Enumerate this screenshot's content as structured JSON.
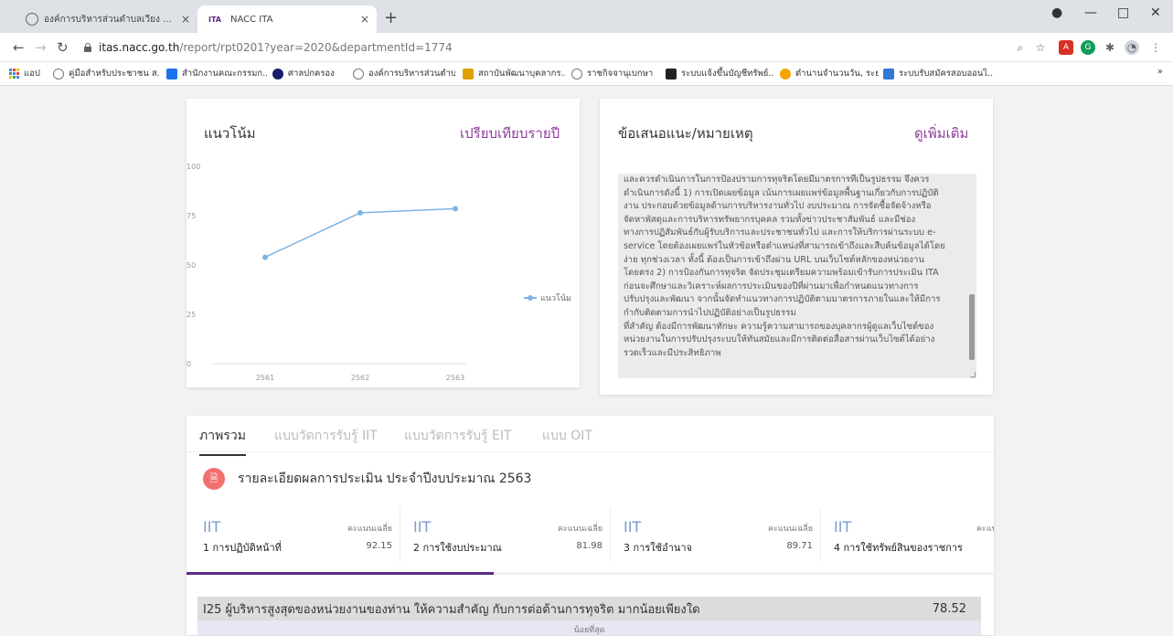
{
  "browser": {
    "tabs": [
      {
        "title": "องค์การบริหารส่วนตำบลเวียง อ.เวียงป่าเป้า",
        "active": false
      },
      {
        "title": "NACC ITA",
        "active": true
      }
    ],
    "tab_favicon_text": "ITA",
    "new_tab": "+",
    "close_glyph": "×",
    "url_host": "itas.nacc.go.th",
    "url_path": "/report/rpt0201?year=2020&departmentId=1774",
    "bookmarks": [
      {
        "label": "แอป",
        "color": "#4285f4"
      },
      {
        "label": "คู่มือสำหรับประชาชน ส...",
        "color": "#888888"
      },
      {
        "label": "สำนักงานคณะกรรมก...",
        "color": "#1a73e8"
      },
      {
        "label": "ศาลปกครอง",
        "color": "#1b1b6b"
      },
      {
        "label": "องค์การบริหารส่วนตำบ...",
        "color": "#888888"
      },
      {
        "label": "สถาบันพัฒนาบุคลากร...",
        "color": "#e0a000"
      },
      {
        "label": "ราชกิจจานุเบกษา",
        "color": "#888888"
      },
      {
        "label": "ระบบแจ้งขึ้นบัญชีทรัพย์...",
        "color": "#222222"
      },
      {
        "label": "ตำนานจำนวนวัน, ระยะ...",
        "color": "#f4a300"
      },
      {
        "label": "ระบบรับสมัครสอบออนไ...",
        "color": "#2f7ad6"
      }
    ],
    "bookmarks_more": "»"
  },
  "trend_card": {
    "title": "แนวโน้ม",
    "link": "เปรียบเทียบรายปี"
  },
  "chart_data": {
    "type": "line",
    "categories": [
      "2561",
      "2562",
      "2563"
    ],
    "series": [
      {
        "name": "แนวโน้ม",
        "values": [
          53.96,
          76.43,
          78.52
        ]
      }
    ],
    "yticks": [
      "0",
      "25",
      "50",
      "75",
      "100"
    ],
    "ylim": [
      0,
      100
    ],
    "grid": false,
    "legend": "right",
    "color": "#7fb3e5"
  },
  "notes_card": {
    "title": "ข้อเสนอแนะ/หมายเหตุ",
    "link": "ดูเพิ่มเติม",
    "lines": [
      "และควรดำเนินการในการป้องปรามการทุจริตโดยมีมาตรการที่เป็นรูปธรรม จึงควร",
      "ดำเนินการดังนี้ 1) การเปิดเผยข้อมูล เน้นการเผยแพร่ข้อมูลพื้นฐานเกี่ยวกับการปฏิบัติ",
      "งาน ประกอบด้วยข้อมูลด้านการบริหารงานทั่วไป งบประมาณ การจัดซื้อจัดจ้างหรือ",
      "จัดหาพัสดุและการบริหารทรัพยากรบุคคล รวมทั้งข่าวประชาสัมพันธ์ และมีช่อง",
      "ทางการปฏิสัมพันธ์กับผู้รับบริการและประชาชนทั่วไป และการให้บริการผ่านระบบ e-",
      "service โดยต้องเผยแพร่ในหัวข้อหรือตำแหน่งที่สามารถเข้าถึงและสืบค้นข้อมูลได้โดย",
      "ง่าย ทุกช่วงเวลา ทั้งนี้ ต้องเป็นการเข้าถึงผ่าน URL บนเว็บไซต์หลักของหน่วยงาน",
      "โดยตรง 2) การป้องกันการทุจริต จัดประชุมเตรียมความพร้อมเข้ารับการประเมิน ITA",
      "ก่อนจะศึกษาและวิเคราะห์ผลการประเมินของปีที่ผ่านมาเพื่อกำหนดแนวทางการ",
      "ปรับปรุงและพัฒนา จากนั้นจัดทำแนวทางการปฏิบัติตามมาตรการภายในและให้มีการ",
      "กำกับติดตามการนำไปปฏิบัติอย่างเป็นรูปธรรม",
      "ที่สำคัญ ต้องมีการพัฒนาทักษะ ความรู้ความสามารถของบุคลากรผู้ดูแลเว็บไซต์ของ",
      "หน่วยงานในการปรับปรุงระบบให้ทันสมัยและมีการติดต่อสื่อสารผ่านเว็บไซต์ได้อย่าง",
      "รวดเร็วและมีประสิทธิภาพ"
    ]
  },
  "tabs": [
    "ภาพรวม",
    "แบบวัดการรับรู้ IIT",
    "แบบวัดการรับรู้ EIT",
    "แบบ OIT"
  ],
  "detail": {
    "title": "รายละเอียดผลการประเมิน ประจำปีงบประมาณ 2563"
  },
  "score_cards": [
    {
      "code": "IIT",
      "avg_label": "คะแนนเฉลี่ย",
      "name": "1 การปฏิบัติหน้าที่",
      "value": "92.15"
    },
    {
      "code": "IIT",
      "avg_label": "คะแนนเฉลี่ย",
      "name": "2 การใช้งบประมาณ",
      "value": "81.98"
    },
    {
      "code": "IIT",
      "avg_label": "คะแนนเฉลี่ย",
      "name": "3 การใช้อำนาจ",
      "value": "89.71"
    },
    {
      "code": "IIT",
      "avg_label": "คะแนนเฉลี่ย",
      "name": "4 การใช้ทรัพย์สินของราชการ",
      "value": ""
    }
  ],
  "progress": {
    "fraction": 0.38
  },
  "question": {
    "text": "I25 ผู้บริหารสูงสุดของหน่วยงานของท่าน ให้ความสำคัญ กับการต่อต้านการทุจริต มากน้อยเพียงใด",
    "score": "78.52",
    "sub": "น้อยที่สุด"
  }
}
